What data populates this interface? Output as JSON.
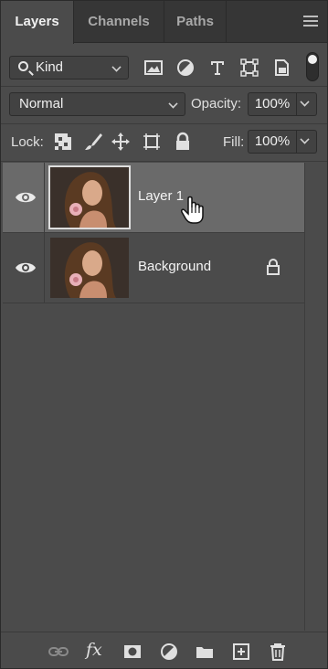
{
  "tabs": [
    {
      "label": "Layers",
      "active": true
    },
    {
      "label": "Channels",
      "active": false
    },
    {
      "label": "Paths",
      "active": false
    }
  ],
  "filter": {
    "kind_label": "Kind",
    "icons": [
      "pixel-layer-filter-icon",
      "adjustment-layer-filter-icon",
      "type-layer-filter-icon",
      "shape-layer-filter-icon",
      "smart-object-filter-icon"
    ],
    "toggle_on": true
  },
  "blend": {
    "mode": "Normal",
    "opacity_label": "Opacity:",
    "opacity_value": "100%"
  },
  "lock": {
    "label": "Lock:",
    "icons": [
      "lock-transparent-pixels-icon",
      "lock-image-pixels-icon",
      "lock-position-icon",
      "prevent-autonest-icon",
      "lock-all-icon"
    ],
    "fill_label": "Fill:",
    "fill_value": "100%"
  },
  "layers": [
    {
      "name": "Layer 1",
      "selected": true,
      "visible": true,
      "locked": false
    },
    {
      "name": "Background",
      "selected": false,
      "visible": true,
      "locked": true
    }
  ],
  "bottom_icons": [
    "link-layers-icon",
    "fx-icon",
    "add-mask-icon",
    "adjustment-layer-icon",
    "new-group-icon",
    "new-layer-icon",
    "delete-icon"
  ],
  "bottom_fx_label": "fx",
  "colors": {
    "panel": "#4b4b4b",
    "tabbar": "#363636",
    "selected_layer": "#6a6a6a"
  }
}
